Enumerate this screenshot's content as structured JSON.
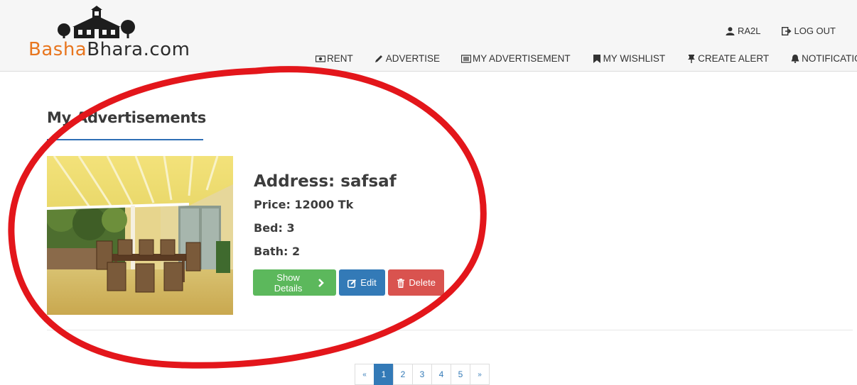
{
  "brand": {
    "part1": "Basha",
    "part2": "Bhara.com"
  },
  "topbar": {
    "user": "RA2L",
    "logout": "LOG OUT"
  },
  "menu": {
    "rent": "RENT",
    "advertise": "ADVERTISE",
    "my_advertisement": "MY ADVERTISEMENT",
    "wishlist": "MY WISHLIST",
    "create_alert": "CREATE ALERT",
    "notifications": "NOTIFICATIONS"
  },
  "page": {
    "title": "My Advertisements"
  },
  "listing": {
    "address_label": "Address:",
    "address": "safsaf",
    "price_label": "Price:",
    "price": "12000 Tk",
    "bed_label": "Bed:",
    "bed": "3",
    "bath_label": "Bath:",
    "bath": "2"
  },
  "buttons": {
    "show_details": "Show Details",
    "edit": "Edit",
    "delete": "Delete"
  },
  "pagination": {
    "prev": "«",
    "next": "»",
    "pages": [
      "1",
      "2",
      "3",
      "4",
      "5"
    ],
    "active": "1"
  },
  "colors": {
    "brand_orange": "#e8761f",
    "primary": "#337ab7",
    "success": "#5cb85c",
    "danger": "#d9534f",
    "annotation": "#e3161b"
  }
}
